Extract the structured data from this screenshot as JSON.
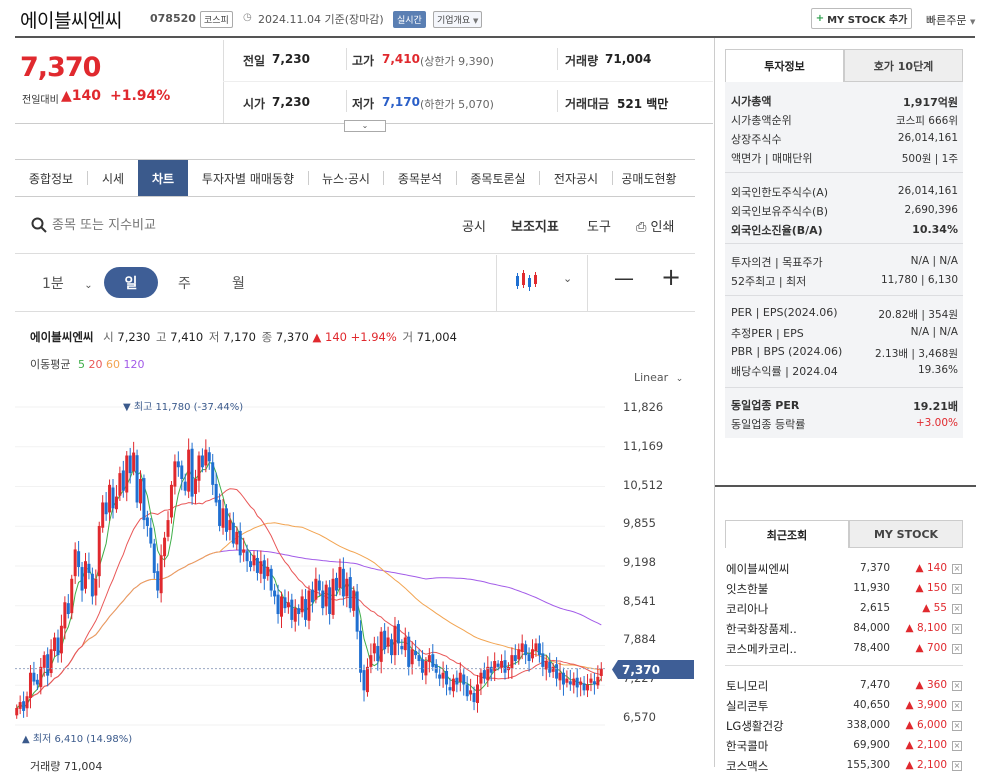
{
  "header": {
    "title": "에이블씨엔씨",
    "code": "078520",
    "market_badge": "코스피",
    "date": "2024.11.04",
    "basis": "기준(장마감)",
    "realtime_badge": "실시간",
    "company_overview": "기업개요",
    "mystock_btn": "MY STOCK 추가",
    "quick_order": "빠른주문"
  },
  "quote": {
    "price": "7,370",
    "change_label": "전일대비",
    "change": "140",
    "change_pct": "+1.94%",
    "prev_label": "전일",
    "prev": "7,230",
    "high_label": "고가",
    "high": "7,410",
    "upper_limit": "(상한가 9,390)",
    "volume_label": "거래량",
    "volume": "71,004",
    "open_label": "시가",
    "open": "7,230",
    "low_label": "저가",
    "low": "7,170",
    "lower_limit": "(하한가 5,070)",
    "amount_label": "거래대금",
    "amount": "521 백만"
  },
  "tabs": [
    "종합정보",
    "시세",
    "차트",
    "투자자별 매매동향",
    "뉴스·공시",
    "종목분석",
    "종목토론실",
    "전자공시",
    "공매도현황"
  ],
  "toolbar": {
    "search_placeholder": "종목 또는 지수비교",
    "disclosure": "공시",
    "indicators": "보조지표",
    "drawing": "도구",
    "print": "인쇄"
  },
  "periods": [
    "1분",
    "일",
    "주",
    "월"
  ],
  "chart_header": {
    "name": "에이블씨엔씨",
    "open_label": "시",
    "open": "7,230",
    "high_label": "고",
    "high": "7,410",
    "low_label": "저",
    "low": "7,170",
    "close_label": "종",
    "close": "7,370",
    "change": "▲ 140 +1.94%",
    "vol_label": "거",
    "vol": "71,004",
    "ma_label": "이동평균",
    "ma5": "5",
    "ma20": "20",
    "ma60": "60",
    "ma120": "120",
    "scale": "Linear",
    "max_label": "▼ 최고 11,780 (-37.44%)",
    "min_label": "▲ 최저 6,410 (14.98%)",
    "current_tag": "7,370",
    "volume_footer": "거래량 71,004"
  },
  "colors": {
    "up": "#e0292e",
    "down": "#1f6fd1",
    "ma5": "#3fae49",
    "ma20": "#e95757",
    "ma60": "#f2a451",
    "ma120": "#a25be8",
    "accent": "#3b5a8c"
  },
  "chart_data": {
    "type": "candlestick",
    "y_ticks": [
      "11,826",
      "11,169",
      "10,512",
      "9,855",
      "9,198",
      "8,541",
      "7,884",
      "7,227",
      "6,570"
    ],
    "ylim": [
      6410,
      11826
    ],
    "close": [
      6700,
      6800,
      6650,
      6900,
      7300,
      7150,
      7100,
      7400,
      7600,
      7250,
      7700,
      7900,
      7600,
      8100,
      8500,
      8300,
      8900,
      9400,
      9100,
      8700,
      9200,
      9000,
      8600,
      8900,
      9800,
      10200,
      10000,
      10500,
      10100,
      10300,
      10700,
      10400,
      11000,
      10700,
      11050,
      10200,
      10600,
      9900,
      9800,
      9500,
      9000,
      8700,
      9300,
      9600,
      9900,
      10500,
      10900,
      10800,
      10600,
      10400,
      11100,
      10300,
      10600,
      11000,
      10800,
      11100,
      10900,
      10500,
      10200,
      9800,
      10100,
      9700,
      9900,
      9500,
      9700,
      9300,
      9400,
      9200,
      9100,
      9300,
      9000,
      9200,
      8900,
      9100,
      8700,
      8600,
      8300,
      8600,
      8400,
      8500,
      8200,
      8400,
      8300,
      8600,
      8200,
      8700,
      8500,
      8900,
      8700,
      8400,
      8800,
      8300,
      8900,
      8700,
      9100,
      8600,
      8900,
      8400,
      8700,
      8000,
      7300,
      7000,
      7400,
      7600,
      7800,
      7500,
      8000,
      7700,
      7900,
      7600,
      8100,
      7800,
      7700,
      7900,
      7400,
      7700,
      7600,
      7500,
      7300,
      7500,
      7600,
      7400,
      7300,
      7200,
      7300,
      7100,
      7000,
      7200,
      7100,
      7300,
      7100,
      6900,
      7000,
      6800,
      7100,
      7300,
      7200,
      7400,
      7300,
      7500,
      7400,
      7500,
      7300,
      7400,
      7600,
      7500,
      7700,
      7800,
      7600,
      7500,
      7700,
      7800,
      7600,
      7400,
      7500,
      7300,
      7400,
      7200,
      7300,
      7100,
      7200,
      7100,
      7200,
      7050,
      7150,
      7000,
      7100,
      7200,
      7100,
      7230,
      7370
    ]
  },
  "right_panel": {
    "tab_info": "투자정보",
    "tab_hoga": "호가 10단계",
    "rows": [
      {
        "label": "시가총액",
        "value": "1,917억원"
      },
      {
        "label": "시가총액순위",
        "value": "코스피 666위"
      },
      {
        "label": "상장주식수",
        "value": "26,014,161"
      },
      {
        "label": "액면가 | 매매단위",
        "value": "500원 | 1주"
      },
      {
        "label": "외국인한도주식수(A)",
        "value": "26,014,161"
      },
      {
        "label": "외국인보유주식수(B)",
        "value": "2,690,396"
      },
      {
        "label": "외국인소진율(B/A)",
        "value": "10.34%"
      },
      {
        "label": "투자의견 | 목표주가",
        "value": "N/A | N/A"
      },
      {
        "label": "52주최고 | 최저",
        "value": "11,780 | 6,130"
      },
      {
        "label": "PER | EPS(2024.06)",
        "value": "20.82배 | 354원"
      },
      {
        "label": "추정PER | EPS",
        "value": "N/A | N/A"
      },
      {
        "label": "PBR | BPS (2024.06)",
        "value": "2.13배 | 3,468원"
      },
      {
        "label": "배당수익률 | 2024.04",
        "value": "19.36%"
      },
      {
        "label": "동일업종 PER",
        "value": "19.21배"
      },
      {
        "label": "동일업종 등락률",
        "value": "+3.00%"
      }
    ],
    "recent_tab": "최근조회",
    "mystock_tab": "MY STOCK",
    "recent": [
      {
        "name": "에이블씨엔씨",
        "price": "7,370",
        "chg": "140"
      },
      {
        "name": "잇츠한불",
        "price": "11,930",
        "chg": "150"
      },
      {
        "name": "코리아나",
        "price": "2,615",
        "chg": "55"
      },
      {
        "name": "한국화장품제..",
        "price": "84,000",
        "chg": "8,100"
      },
      {
        "name": "코스메카코리..",
        "price": "78,400",
        "chg": "700"
      },
      {
        "name": "토니모리",
        "price": "7,470",
        "chg": "360"
      },
      {
        "name": "실리콘투",
        "price": "40,650",
        "chg": "3,900"
      },
      {
        "name": "LG생활건강",
        "price": "338,000",
        "chg": "6,000"
      },
      {
        "name": "한국콜마",
        "price": "69,900",
        "chg": "2,100"
      },
      {
        "name": "코스맥스",
        "price": "155,300",
        "chg": "2,100"
      }
    ]
  }
}
